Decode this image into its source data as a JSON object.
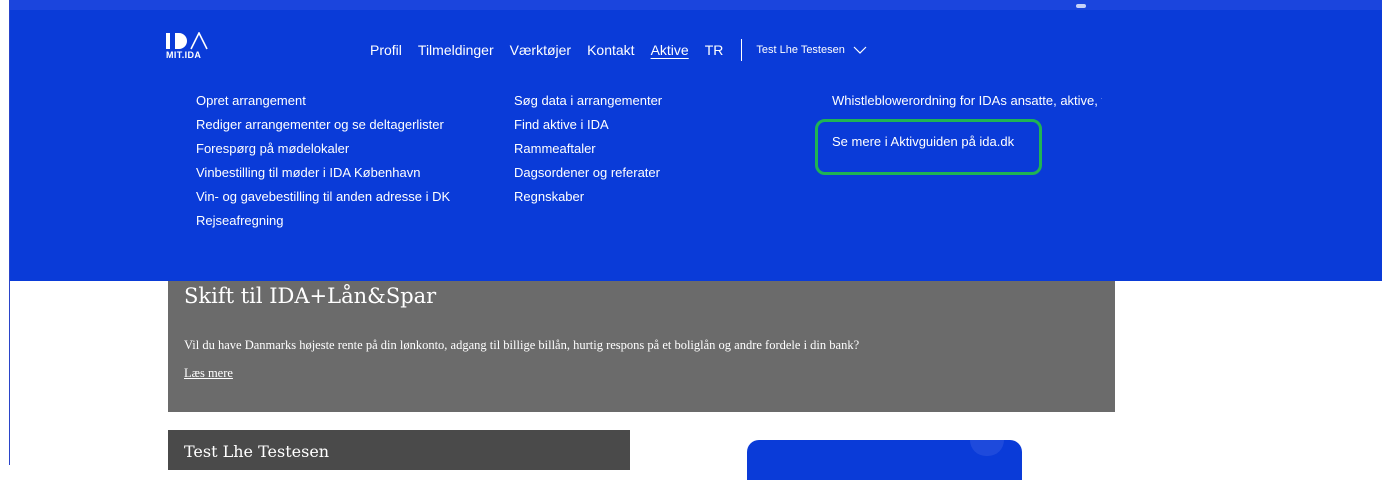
{
  "brand": {
    "logo_text": "MIT.IDA"
  },
  "nav": {
    "items": [
      {
        "label": "Profil",
        "active": false
      },
      {
        "label": "Tilmeldinger",
        "active": false
      },
      {
        "label": "Værktøjer",
        "active": false
      },
      {
        "label": "Kontakt",
        "active": false
      },
      {
        "label": "Aktive",
        "active": true
      },
      {
        "label": "TR",
        "active": false
      }
    ],
    "user_name": "Test Lhe Testesen"
  },
  "dropdown": {
    "col1": [
      "Opret arrangement",
      "Rediger arrangementer og se deltagerlister",
      "Forespørg på mødelokaler",
      "Vinbestilling til møder i IDA København",
      "Vin- og gavebestilling til anden adresse i DK",
      "Rejseafregning"
    ],
    "col2": [
      "Søg data i arrangementer",
      "Find aktive i IDA",
      "Rammeaftaler",
      "Dagsordener og referater",
      "Regnskaber"
    ],
    "col3": {
      "whistleblower": "Whistleblowerordning for IDAs ansatte, aktive, tillidsvalgte m.fl.",
      "guide_link": "Se mere i Aktivguiden på ida.dk"
    }
  },
  "promo": {
    "title": "Skift til IDA+Lån&Spar",
    "body": "Vil du have Danmarks højeste rente på din lønkonto, adgang til billige billån, hurtig respons på et boliglån og andre fordele i din bank?",
    "link": "Læs mere"
  },
  "profile_card": {
    "name": "Test Lhe Testesen"
  },
  "colors": {
    "nav_blue": "#0a3bd8",
    "highlight_green": "#1fb454",
    "promo_gray": "#6b6b6b"
  }
}
